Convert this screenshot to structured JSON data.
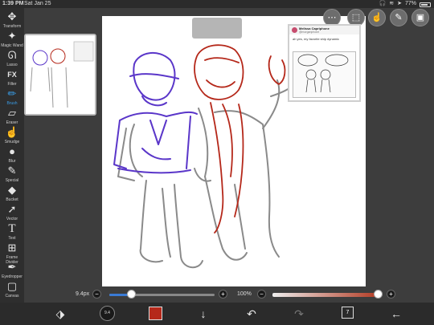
{
  "status_bar": {
    "time": "1:39 PM",
    "date": "Sat Jan 25",
    "battery": "77%",
    "icons": [
      "headphones-icon",
      "wifi-icon",
      "location-icon",
      "battery-icon"
    ]
  },
  "toolbar": {
    "tools": [
      {
        "name": "transform",
        "label": "Transform",
        "icon": "move-icon",
        "glyph": "✥"
      },
      {
        "name": "magic-wand",
        "label": "Magic Wand",
        "icon": "magic-wand-icon",
        "glyph": "✦"
      },
      {
        "name": "lasso",
        "label": "Lasso",
        "icon": "lasso-icon",
        "glyph": "ᘏ"
      },
      {
        "name": "filter",
        "label": "Filter",
        "icon": "fx-icon",
        "glyph": "FX"
      },
      {
        "name": "brush",
        "label": "Brush",
        "icon": "brush-icon",
        "glyph": "✏"
      },
      {
        "name": "eraser",
        "label": "Eraser",
        "icon": "eraser-icon",
        "glyph": "▱"
      },
      {
        "name": "smudge",
        "label": "Smudge",
        "icon": "smudge-icon",
        "glyph": "☝"
      },
      {
        "name": "blur",
        "label": "Blur",
        "icon": "drop-icon",
        "glyph": "💧"
      },
      {
        "name": "special",
        "label": "Special",
        "icon": "special-pen-icon",
        "glyph": "✎"
      },
      {
        "name": "bucket",
        "label": "Bucket",
        "icon": "bucket-icon",
        "glyph": "⛾"
      },
      {
        "name": "vector",
        "label": "Vector",
        "icon": "cursor-icon",
        "glyph": "➚"
      },
      {
        "name": "text",
        "label": "Text",
        "icon": "text-icon",
        "glyph": "T"
      },
      {
        "name": "frame-divider",
        "label": "Frame Divider",
        "icon": "frame-icon",
        "glyph": "⊞"
      },
      {
        "name": "eyedropper",
        "label": "Eyedropper",
        "icon": "eyedropper-icon",
        "glyph": "✒"
      },
      {
        "name": "canvas",
        "label": "Canvas",
        "icon": "canvas-icon",
        "glyph": "▢"
      }
    ],
    "active_tool": "brush"
  },
  "top_right_buttons": [
    {
      "name": "menu-button",
      "icon": "toggle-icon",
      "glyph": "⋯"
    },
    {
      "name": "selection-button",
      "icon": "selection-icon",
      "glyph": "⬚"
    },
    {
      "name": "gesture-button",
      "icon": "hand-icon",
      "glyph": "☝"
    },
    {
      "name": "ruler-button",
      "icon": "pen-icon",
      "glyph": "✎"
    },
    {
      "name": "import-image-button",
      "icon": "image-icon",
      "glyph": "▣"
    }
  ],
  "reference": {
    "name": "Melissa Capriphone",
    "handle": "@morganphone",
    "text": "ah yes, my favorite ship dynamic"
  },
  "slider": {
    "brush_size": "9.4px",
    "brush_size_value": 0.2,
    "opacity": "100%",
    "opacity_value": 1.0,
    "minus": "−",
    "plus": "+"
  },
  "bottom_toolbar": {
    "brush_preview": "9.4",
    "color": "#b5281a",
    "layer_count": "7",
    "icons": [
      "quick-tool-icon",
      "brush-size-icon",
      "color-icon",
      "down-arrow-icon",
      "undo-icon",
      "redo-icon",
      "layers-icon",
      "back-icon"
    ]
  },
  "colors": {
    "purple_stroke": "#5a36c9",
    "red_stroke": "#b5281a",
    "accent_blue": "#3a9ee8"
  }
}
